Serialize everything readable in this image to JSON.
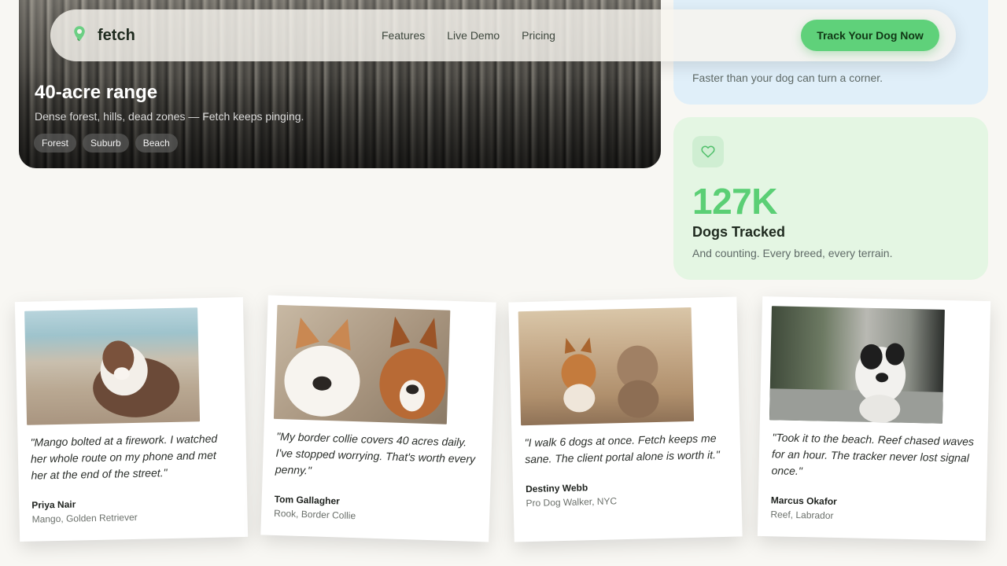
{
  "nav": {
    "brand": "fetch",
    "links": [
      "Features",
      "Live Demo",
      "Pricing"
    ],
    "cta": "Track Your Dog Now"
  },
  "hero": {
    "title": "40-acre range",
    "subtitle": "Dense forest, hills, dead zones — Fetch keeps pinging.",
    "tags": [
      "Forest",
      "Suburb",
      "Beach"
    ]
  },
  "cards": {
    "speed_desc": "Faster than your dog can turn a corner.",
    "tracked": {
      "value": "127K",
      "label": "Dogs Tracked",
      "desc": "And counting. Every breed, every terrain."
    }
  },
  "testimonials": [
    {
      "quote": "\"Mango bolted at a firework. I watched her whole route on my phone and met her at the end of the street.\"",
      "author": "Priya Nair",
      "dog": "Mango, Golden Retriever"
    },
    {
      "quote": "\"My border collie covers 40 acres daily. I've stopped worrying. That's worth every penny.\"",
      "author": "Tom Gallagher",
      "dog": "Rook, Border Collie"
    },
    {
      "quote": "\"I walk 6 dogs at once. Fetch keeps me sane. The client portal alone is worth it.\"",
      "author": "Destiny Webb",
      "dog": "Pro Dog Walker, NYC"
    },
    {
      "quote": "\"Took it to the beach. Reef chased waves for an hour. The tracker never lost signal once.\"",
      "author": "Marcus Okafor",
      "dog": "Reef, Labrador"
    }
  ],
  "colors": {
    "accent_green": "#5fd17a",
    "stat_green": "#5bcf75",
    "card_blue": "#e0eff9",
    "card_green": "#e4f6e3",
    "page_bg": "#f8f7f3"
  },
  "icons": {
    "brand": "location-pin-icon",
    "stat": "heart-icon"
  }
}
